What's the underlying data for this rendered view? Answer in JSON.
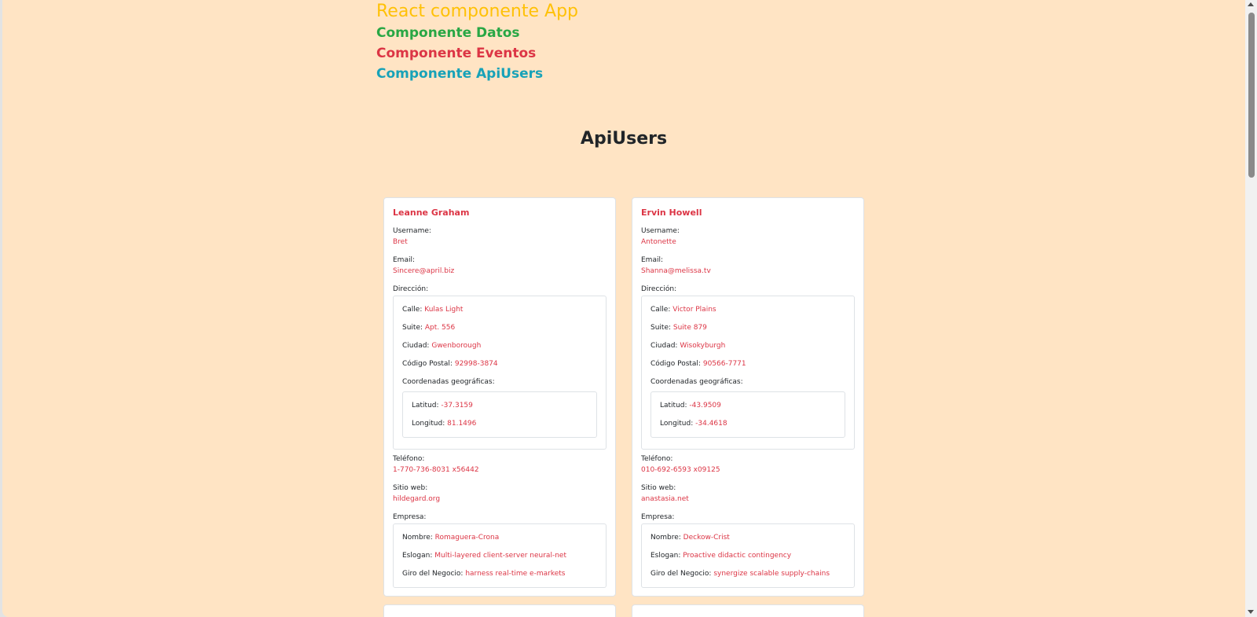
{
  "header": {
    "app_title": "React componente App",
    "components": [
      {
        "label": "Componente Datos",
        "color": "#28a745"
      },
      {
        "label": "Componente Eventos",
        "color": "#dc3545"
      },
      {
        "label": "Componente ApiUsers",
        "color": "#17a2b8"
      }
    ],
    "app_title_color": "#ffc107"
  },
  "main": {
    "title": "ApiUsers"
  },
  "labels": {
    "username": "Username:",
    "email": "Email:",
    "address": "Dirección:",
    "street": "Calle:",
    "suite": "Suite:",
    "city": "Ciudad:",
    "zipcode": "Código Postal:",
    "geo": "Coordenadas geográficas:",
    "lat": "Latitud:",
    "lng": "Longitud:",
    "phone": "Teléfono:",
    "website": "Sitio web:",
    "company": "Empresa:",
    "company_name": "Nombre:",
    "catchphrase": "Eslogan:",
    "bs": "Giro del Negocio:"
  },
  "users": [
    {
      "name": "Leanne Graham",
      "username": "Bret",
      "email": "Sincere@april.biz",
      "street": "Kulas Light",
      "suite": "Apt. 556",
      "city": "Gwenborough",
      "zipcode": "92998-3874",
      "lat": "-37.3159",
      "lng": "81.1496",
      "phone": "1-770-736-8031 x56442",
      "website": "hildegard.org",
      "company_name": "Romaguera-Crona",
      "catchphrase": "Multi-layered client-server neural-net",
      "bs": "harness real-time e-markets"
    },
    {
      "name": "Ervin Howell",
      "username": "Antonette",
      "email": "Shanna@melissa.tv",
      "street": "Victor Plains",
      "suite": "Suite 879",
      "city": "Wisokyburgh",
      "zipcode": "90566-7771",
      "lat": "-43.9509",
      "lng": "-34.4618",
      "phone": "010-692-6593 x09125",
      "website": "anastasia.net",
      "company_name": "Deckow-Crist",
      "catchphrase": "Proactive didactic contingency",
      "bs": "synergize scalable supply-chains"
    }
  ]
}
